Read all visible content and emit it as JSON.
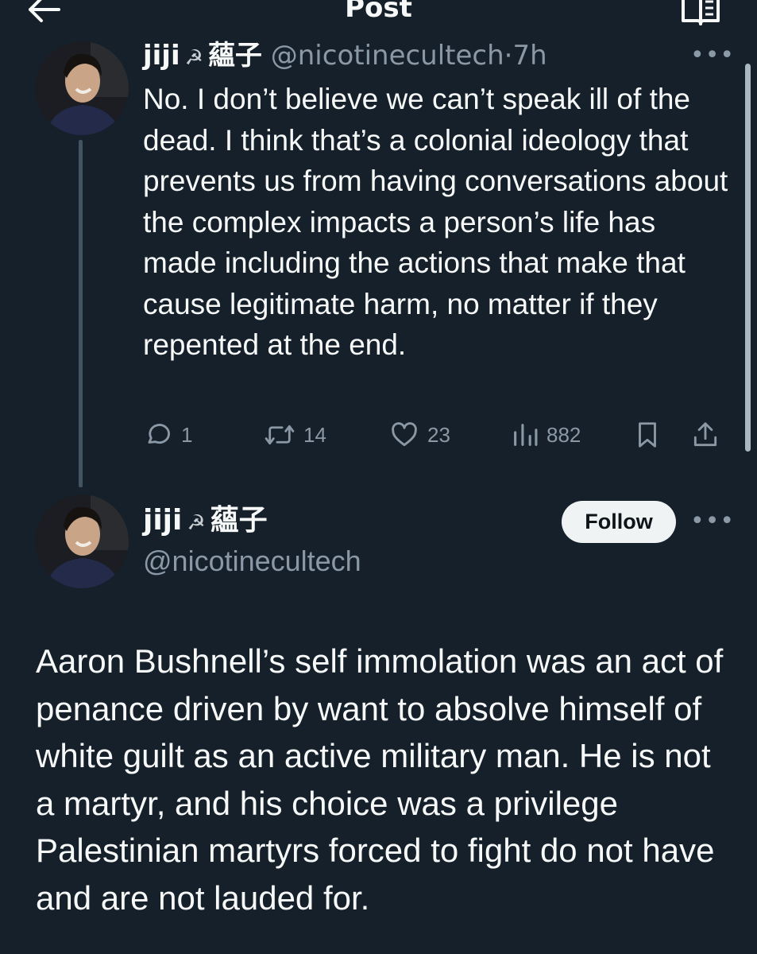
{
  "header": {
    "title": "Post",
    "back_icon": "arrow-left-icon",
    "reader_icon": "book-open-icon"
  },
  "parent_tweet": {
    "display_name": "jiji",
    "emoji": "☭",
    "name_suffix": "蘊子",
    "handle": "@nicotinecultech",
    "separator": "·",
    "time": "7h",
    "text": "No. I don’t believe we can’t speak ill of the dead. I think that’s a colonial ideology that prevents us from having conversations about the complex impacts a person’s life has made including the actions that make that cause legitimate harm, no matter if they repented at the end.",
    "more": "•••",
    "stats": {
      "replies": "1",
      "reposts": "14",
      "likes": "23",
      "views": "882"
    }
  },
  "main_tweet": {
    "display_name": "jiji",
    "emoji": "☭",
    "name_suffix": "蘊子",
    "handle": "@nicotinecultech",
    "follow_label": "Follow",
    "more": "•••",
    "text": "Aaron Bushnell’s self immolation was an act of penance driven by want to absolve himself of white guilt as an active military man. He is not a martyr, and his choice was a privilege Palestinian martyrs forced to fight do not have and are not lauded for."
  },
  "colors": {
    "background": "#15202b",
    "text": "#f7f9f9",
    "secondary": "#8b98a5",
    "follow_bg": "#eff3f4",
    "thread_line": "#425362"
  }
}
